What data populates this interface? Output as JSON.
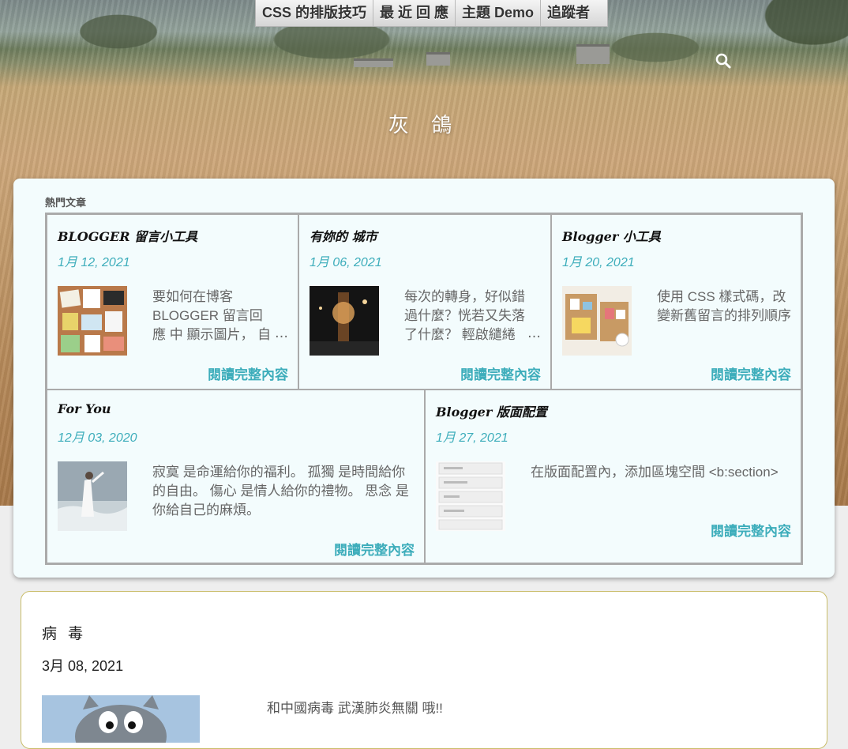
{
  "nav": {
    "items": [
      "CSS 的排版技巧",
      "最 近 回 應",
      "主題 Demo",
      "追蹤者"
    ]
  },
  "header": {
    "title": "灰 鴿"
  },
  "search": {
    "icon": "search-icon"
  },
  "popular": {
    "heading": "熱門文章",
    "posts": [
      {
        "title": "BLOGGER 留言小工具",
        "date": "1月 12, 2021",
        "snippet": "要如何在博客 BLOGGER 留言回應 中 顯示圖片， 自動",
        "ellipsis": "…",
        "read_more": "閱讀完整內容",
        "thumb": "corkboard-notes"
      },
      {
        "title": "有妳的 城市",
        "date": "1月 06, 2021",
        "snippet": "每次的轉身，好似錯過什麼？恍若又失落了什麼？ 輕啟繾綣",
        "ellipsis": "…",
        "read_more": "閱讀完整內容",
        "thumb": "night-city"
      },
      {
        "title": "Blogger 小工具",
        "date": "1月 20, 2021",
        "snippet": "使用 CSS 樣式碼，改變新舊留言的排列順序",
        "read_more": "閱讀完整內容",
        "thumb": "corkboard-cards"
      },
      {
        "title": "For You",
        "date": "12月 03, 2020",
        "snippet": "寂寞 是命運給你的福利。 孤獨 是時間給你的自由。 傷心 是情人給你的禮物。 思念 是你給自己的麻煩。",
        "read_more": "閱讀完整內容",
        "thumb": "woman-by-sea"
      },
      {
        "title": "Blogger 版面配置",
        "date": "1月 27, 2021",
        "snippet": "在版面配置內，添加區塊空間 <b:section>",
        "read_more": "閱讀完整內容",
        "thumb": "layout-screenshot"
      }
    ]
  },
  "post": {
    "title": "病 毒",
    "date": "3月 08, 2021",
    "snippet": "和中國病毒 武漢肺炎無關 哦!!",
    "thumb": "cartoon-cat"
  }
}
